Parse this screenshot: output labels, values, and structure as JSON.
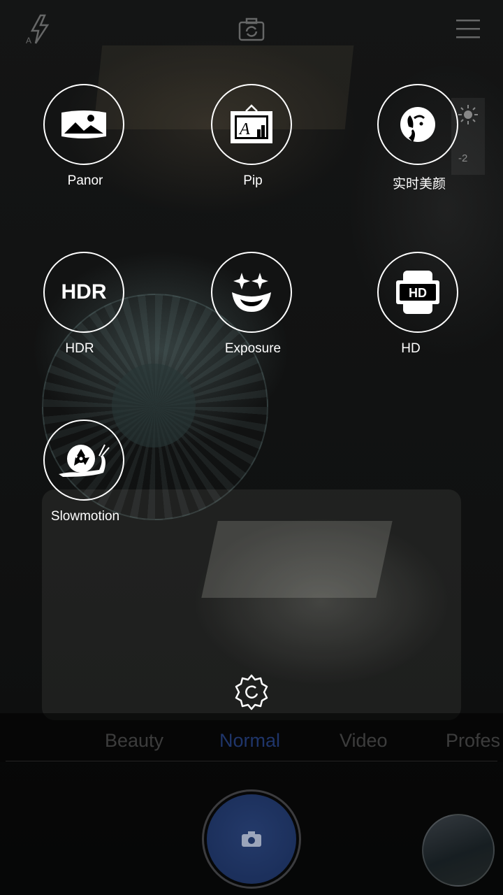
{
  "top_bar": {
    "flash_icon": "flash-auto-icon",
    "switch_camera_icon": "camera-switch-icon",
    "menu_icon": "menu-icon"
  },
  "modes": [
    {
      "label": "Panor",
      "icon": "panorama-icon"
    },
    {
      "label": "Pip",
      "icon": "picture-in-picture-icon"
    },
    {
      "label": "实时美颜",
      "icon": "beauty-face-icon"
    },
    {
      "label": "HDR",
      "icon": "hdr-icon",
      "icon_text": "HDR"
    },
    {
      "label": "Exposure",
      "icon": "exposure-clown-icon"
    },
    {
      "label": "HD",
      "icon": "hd-icon",
      "icon_text": "HD"
    },
    {
      "label": "Slowmotion",
      "icon": "slowmotion-snail-icon"
    }
  ],
  "exposure": {
    "value": "-2"
  },
  "settings_icon": "settings-gear-icon",
  "tabs": [
    "Beauty",
    "Normal",
    "Video",
    "Profes"
  ],
  "active_tab": "Normal",
  "colors": {
    "active_tab": "#28468c",
    "shutter": "#1d3260",
    "mode_outline": "#ffffff"
  },
  "shutter_icon": "camera-icon",
  "gallery_thumbnail": "gallery-thumbnail"
}
